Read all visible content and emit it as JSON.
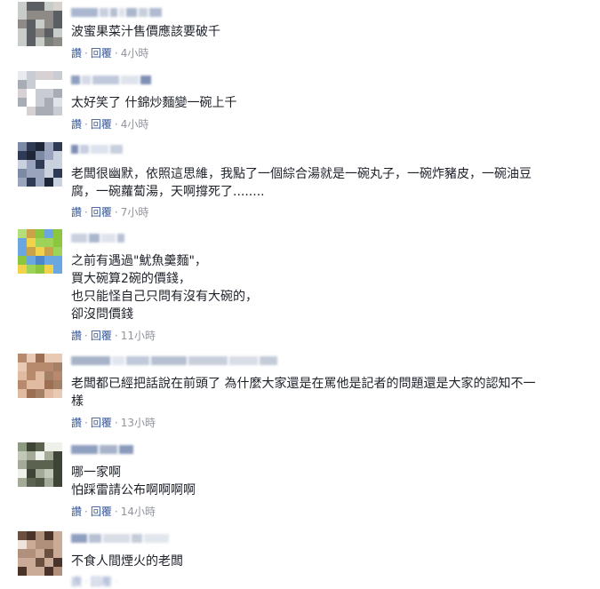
{
  "actions": {
    "like": "讚",
    "reply": "回覆",
    "dot": "·"
  },
  "comments": [
    {
      "text": "波蜜果菜汁售價應該要破千",
      "time": "4小時"
    },
    {
      "text": "太好笑了 什錦炒麵變一碗上千",
      "time": "4小時"
    },
    {
      "text": "老闆很幽默，依照這思維，我點了一個綜合湯就是一碗丸子，一碗炸豬皮，一碗油豆\n腐，一碗蘿蔔湯，天啊撐死了........",
      "time": "7小時"
    },
    {
      "text": "之前有遇過\"魷魚羹麵\"，\n買大碗算2碗的價錢，\n也只能怪自己只問有沒有大碗的，\n卻沒問價錢",
      "time": "11小時"
    },
    {
      "text": "老闆都已經把話說在前頭了 為什麼大家還是在罵他是記者的問題還是大家的認知不一\n樣",
      "time": "13小時"
    },
    {
      "text": "哪一家啊\n怕踩雷請公布啊啊啊啊",
      "time": "14小時"
    },
    {
      "text": "不食人間煙火的老闆",
      "time": ""
    }
  ],
  "colors": {
    "link": "#385898",
    "meta": "#90949c",
    "text": "#1d2129"
  }
}
